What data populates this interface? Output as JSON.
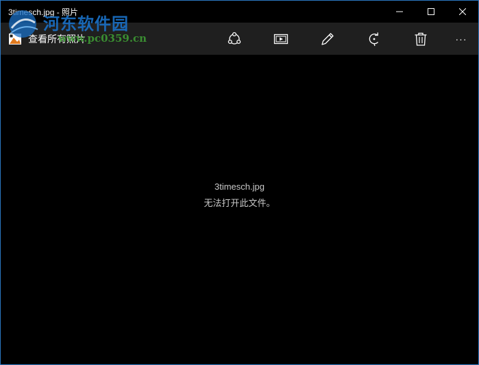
{
  "window": {
    "title": "3timesch.jpg - 照片",
    "border_color": "#2b78c2",
    "controls": [
      "minimize-icon",
      "maximize-icon",
      "close-icon"
    ]
  },
  "command_bar": {
    "back_label": "查看所有照片",
    "tools": [
      {
        "name": "share",
        "icon": "share-icon"
      },
      {
        "name": "slideshow",
        "icon": "slideshow-icon"
      },
      {
        "name": "edit",
        "icon": "pencil-icon"
      },
      {
        "name": "rotate",
        "icon": "rotate-icon"
      },
      {
        "name": "delete",
        "icon": "trash-icon"
      },
      {
        "name": "more",
        "icon": "more-icon",
        "label": "···"
      }
    ]
  },
  "watermark": {
    "text": "河东软件园",
    "url": "www.pc0359.cn"
  },
  "content": {
    "filename": "3timesch.jpg",
    "error_message": "无法打开此文件。"
  },
  "colors": {
    "background": "#000000",
    "command_bar": "#1f1f1f",
    "text_secondary": "#c8c8c8"
  }
}
